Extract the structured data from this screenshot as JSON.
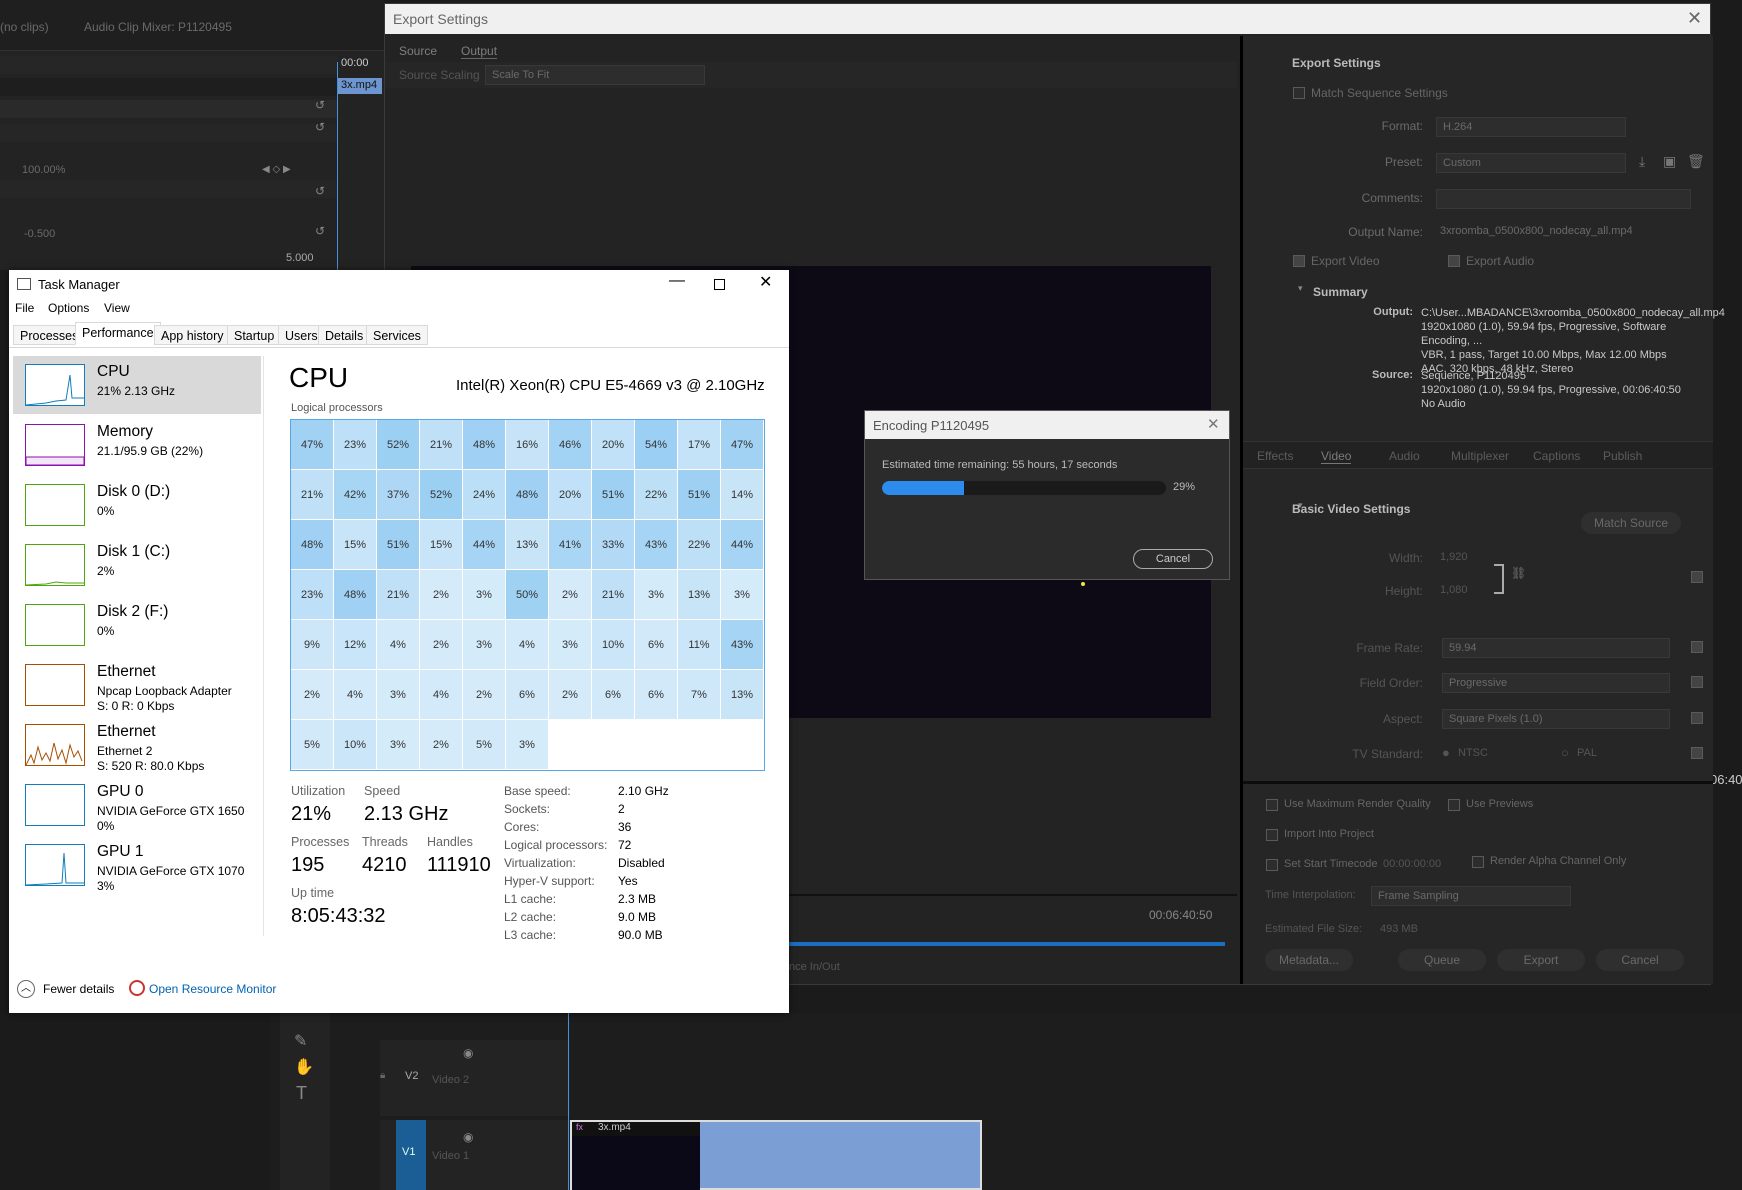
{
  "premiere": {
    "no_clips": "(no clips)",
    "mixer_title": "Audio Clip Mixer: P1120495",
    "timecode_top": "00:00",
    "clip_name": "3x.mp4",
    "percent": "100.00%",
    "val_neg": "-0.500",
    "val_pos": "5.000",
    "track_v2_label": "V2",
    "track_v2_name": "Video 2",
    "track_v1_label": "V1",
    "track_v1_name": "Video 1",
    "timeline_clip": "3x.mp4",
    "timecode_right": "06:40",
    "source_timecode": "00:06:40:50",
    "range_label": "nce In/Out"
  },
  "export_settings": {
    "window_title": "Export Settings",
    "tabs": [
      "Source",
      "Output"
    ],
    "source_scaling_label": "Source Scaling",
    "source_scaling_value": "Scale To Fit",
    "section_title": "Export Settings",
    "match_sequence": "Match Sequence Settings",
    "format_label": "Format:",
    "format_value": "H.264",
    "preset_label": "Preset:",
    "preset_value": "Custom",
    "comments_label": "Comments:",
    "output_name_label": "Output Name:",
    "output_name_value": "3xroomba_0500x800_nodecay_all.mp4",
    "export_video": "Export Video",
    "export_audio": "Export Audio",
    "summary_title": "Summary",
    "output_label": "Output:",
    "output_lines": [
      "C:\\User...MBADANCE\\3xroomba_0500x800_nodecay_all.mp4",
      "1920x1080 (1.0), 59.94 fps, Progressive, Software Encoding, ...",
      "VBR, 1 pass, Target 10.00 Mbps, Max 12.00 Mbps",
      "AAC, 320 kbps, 48 kHz, Stereo"
    ],
    "source_label": "Source:",
    "source_lines": [
      "Sequence, P1120495",
      "1920x1080 (1.0), 59.94 fps, Progressive, 00:06:40:50",
      "No Audio"
    ],
    "settings_tabs": [
      "Effects",
      "Video",
      "Audio",
      "Multiplexer",
      "Captions",
      "Publish"
    ],
    "basic_video_title": "Basic Video Settings",
    "match_source": "Match Source",
    "width_label": "Width:",
    "width_value": "1,920",
    "height_label": "Height:",
    "height_value": "1,080",
    "frame_rate_label": "Frame Rate:",
    "frame_rate_value": "59.94",
    "field_order_label": "Field Order:",
    "field_order_value": "Progressive",
    "aspect_label": "Aspect:",
    "aspect_value": "Square Pixels (1.0)",
    "tv_standard_label": "TV Standard:",
    "ntsc": "NTSC",
    "pal": "PAL",
    "max_render": "Use Maximum Render Quality",
    "use_previews": "Use Previews",
    "import_project": "Import Into Project",
    "set_start_timecode": "Set Start Timecode",
    "start_timecode_value": "00:00:00:00",
    "render_alpha": "Render Alpha Channel Only",
    "time_interp_label": "Time Interpolation:",
    "time_interp_value": "Frame Sampling",
    "file_size_label": "Estimated File Size:",
    "file_size_value": "493 MB",
    "btn_metadata": "Metadata...",
    "btn_queue": "Queue",
    "btn_export": "Export",
    "btn_cancel": "Cancel"
  },
  "encoding": {
    "title": "Encoding P1120495",
    "estimate": "Estimated time remaining: 55 hours, 17 seconds",
    "progress_fraction": 0.29,
    "progress_text": "29%",
    "cancel": "Cancel",
    "accent": "#2d8ceb"
  },
  "task_manager": {
    "title": "Task Manager",
    "menu": [
      "File",
      "Options",
      "View"
    ],
    "tabs": [
      "Processes",
      "Performance",
      "App history",
      "Startup",
      "Users",
      "Details",
      "Services"
    ],
    "sidebar": [
      {
        "title": "CPU",
        "sub1": "21% 2.13 GHz",
        "sub2": "",
        "color": "#117dbb"
      },
      {
        "title": "Memory",
        "sub1": "21.1/95.9 GB (22%)",
        "sub2": "",
        "color": "#8b12ae"
      },
      {
        "title": "Disk 0 (D:)",
        "sub1": "0%",
        "sub2": "",
        "color": "#4da60c"
      },
      {
        "title": "Disk 1 (C:)",
        "sub1": "2%",
        "sub2": "",
        "color": "#4da60c"
      },
      {
        "title": "Disk 2 (F:)",
        "sub1": "0%",
        "sub2": "",
        "color": "#4da60c"
      },
      {
        "title": "Ethernet",
        "sub1": "Npcap Loopback Adapter",
        "sub2": "S: 0 R: 0 Kbps",
        "color": "#a74f01"
      },
      {
        "title": "Ethernet",
        "sub1": "Ethernet 2",
        "sub2": "S: 520 R: 80.0 Kbps",
        "color": "#a74f01"
      },
      {
        "title": "GPU 0",
        "sub1": "NVIDIA GeForce GTX 1650",
        "sub2": "0%",
        "color": "#117dbb"
      },
      {
        "title": "GPU 1",
        "sub1": "NVIDIA GeForce GTX 1070",
        "sub2": "3%",
        "color": "#117dbb"
      }
    ],
    "cpu_heading": "CPU",
    "cpu_model": "Intel(R) Xeon(R) CPU E5-4669 v3 @ 2.10GHz",
    "logical_processors_label": "Logical processors",
    "cores": [
      "47%",
      "23%",
      "52%",
      "21%",
      "48%",
      "16%",
      "46%",
      "20%",
      "54%",
      "17%",
      "47%",
      "21%",
      "42%",
      "37%",
      "52%",
      "24%",
      "48%",
      "20%",
      "51%",
      "22%",
      "51%",
      "14%",
      "48%",
      "15%",
      "51%",
      "15%",
      "44%",
      "13%",
      "41%",
      "33%",
      "43%",
      "22%",
      "44%",
      "23%",
      "48%",
      "21%",
      "2%",
      "3%",
      "50%",
      "2%",
      "21%",
      "3%",
      "13%",
      "3%",
      "9%",
      "12%",
      "4%",
      "2%",
      "3%",
      "4%",
      "3%",
      "10%",
      "6%",
      "11%",
      "43%",
      "2%",
      "4%",
      "3%",
      "4%",
      "2%",
      "6%",
      "2%",
      "6%",
      "6%",
      "7%",
      "13%",
      "5%",
      "10%",
      "3%",
      "2%",
      "5%",
      "3%"
    ],
    "utilization_label": "Utilization",
    "utilization": "21%",
    "speed_label": "Speed",
    "speed": "2.13 GHz",
    "processes_label": "Processes",
    "processes": "195",
    "threads_label": "Threads",
    "threads": "4210",
    "handles_label": "Handles",
    "handles": "111910",
    "uptime_label": "Up time",
    "uptime": "8:05:43:32",
    "specs": [
      [
        "Base speed:",
        "2.10 GHz"
      ],
      [
        "Sockets:",
        "2"
      ],
      [
        "Cores:",
        "36"
      ],
      [
        "Logical processors:",
        "72"
      ],
      [
        "Virtualization:",
        "Disabled"
      ],
      [
        "Hyper-V support:",
        "Yes"
      ],
      [
        "L1 cache:",
        "2.3 MB"
      ],
      [
        "L2 cache:",
        "9.0 MB"
      ],
      [
        "L3 cache:",
        "90.0 MB"
      ]
    ],
    "fewer_details": "Fewer details",
    "open_resource_monitor": "Open Resource Monitor"
  }
}
